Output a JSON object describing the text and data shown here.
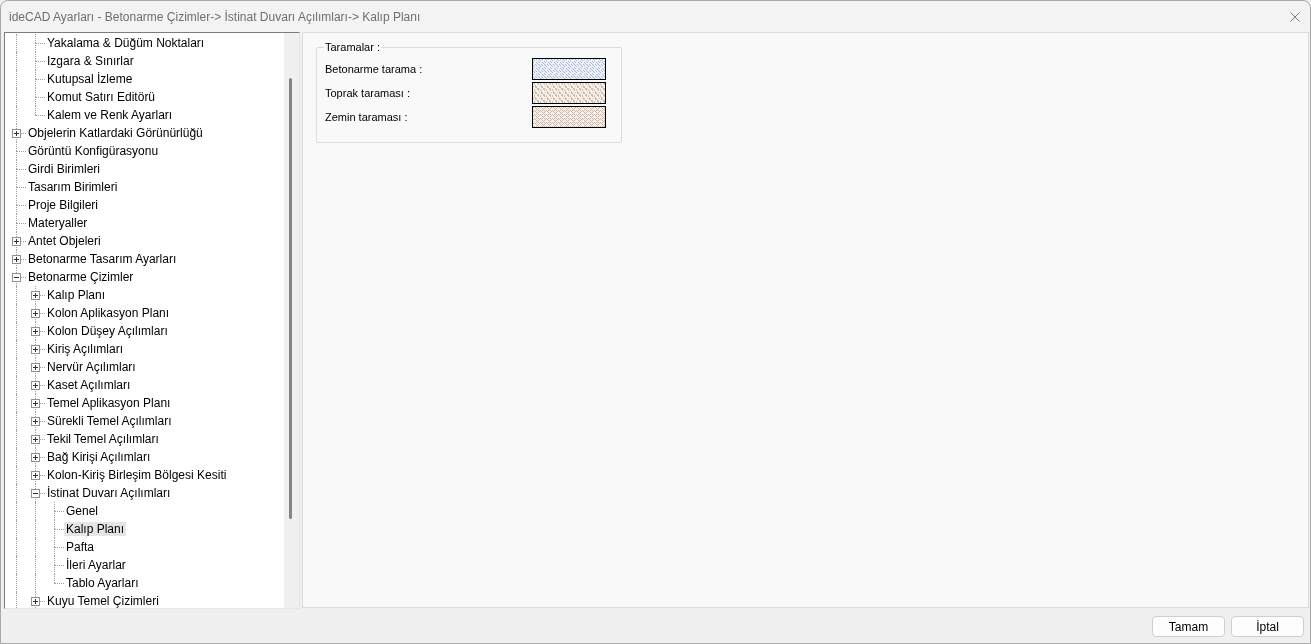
{
  "window": {
    "title": "ideCAD Ayarları - Betonarme Çizimler-> İstinat Duvarı Açılımları-> Kalıp Planı"
  },
  "tree": {
    "items": [
      {
        "children": [
          {
            "label": "Yakalama & Düğüm Noktaları",
            "selected": false
          },
          {
            "label": "Izgara & Sınırlar",
            "selected": false
          },
          {
            "label": "Kutupsal İzleme",
            "selected": false
          },
          {
            "label": "Komut Satırı Editörü",
            "selected": false
          },
          {
            "label": "Kalem ve Renk Ayarları",
            "selected": false
          }
        ]
      },
      {
        "label": "Objelerin Katlardaki Görünürlüğü",
        "expanded": false,
        "selected": false
      },
      {
        "label": "Görüntü Konfigürasyonu",
        "selected": false
      },
      {
        "label": "Girdi Birimleri",
        "selected": false
      },
      {
        "label": "Tasarım Birimleri",
        "selected": false
      },
      {
        "label": "Proje Bilgileri",
        "selected": false
      },
      {
        "label": "Materyaller",
        "selected": false
      },
      {
        "label": "Antet Objeleri",
        "expanded": false,
        "selected": false
      },
      {
        "label": "Betonarme Tasarım Ayarları",
        "expanded": false,
        "selected": false
      },
      {
        "label": "Betonarme Çizimler",
        "expanded": true,
        "selected": false,
        "children": [
          {
            "label": "Kalıp Planı",
            "expanded": false,
            "selected": false
          },
          {
            "label": "Kolon Aplikasyon Planı",
            "expanded": false,
            "selected": false
          },
          {
            "label": "Kolon Düşey Açılımları",
            "expanded": false,
            "selected": false
          },
          {
            "label": "Kiriş Açılımları",
            "expanded": false,
            "selected": false
          },
          {
            "label": "Nervür Açılımları",
            "expanded": false,
            "selected": false
          },
          {
            "label": "Kaset Açılımları",
            "expanded": false,
            "selected": false
          },
          {
            "label": "Temel Aplikasyon Planı",
            "expanded": false,
            "selected": false
          },
          {
            "label": "Sürekli Temel Açılımları",
            "expanded": false,
            "selected": false
          },
          {
            "label": "Tekil Temel Açılımları",
            "expanded": false,
            "selected": false
          },
          {
            "label": "Bağ Kirişi Açılımları",
            "expanded": false,
            "selected": false
          },
          {
            "label": "Kolon-Kiriş Birleşim Bölgesi Kesiti",
            "expanded": false,
            "selected": false
          },
          {
            "label": "İstinat Duvarı Açılımları",
            "expanded": true,
            "selected": false,
            "children": [
              {
                "label": "Genel",
                "selected": false
              },
              {
                "label": "Kalıp Planı",
                "selected": true
              },
              {
                "label": "Pafta",
                "selected": false
              },
              {
                "label": "İleri Ayarlar",
                "selected": false
              },
              {
                "label": "Tablo Ayarları",
                "selected": false
              }
            ]
          },
          {
            "label": "Kuyu Temel Çizimleri",
            "expanded": false,
            "selected": false
          }
        ]
      }
    ]
  },
  "hatches": {
    "title": "Taramalar :",
    "rows": [
      {
        "label": "Betonarme tarama :",
        "kind": "diagonal",
        "color": "#a3b8d6"
      },
      {
        "label": "Toprak taraması :",
        "kind": "speckle",
        "color": "#d4bcaa"
      },
      {
        "label": "Zemin taraması :",
        "kind": "zigzag",
        "color": "#d2b4a4"
      }
    ]
  },
  "buttons": [
    "Tamam",
    "İptal"
  ]
}
